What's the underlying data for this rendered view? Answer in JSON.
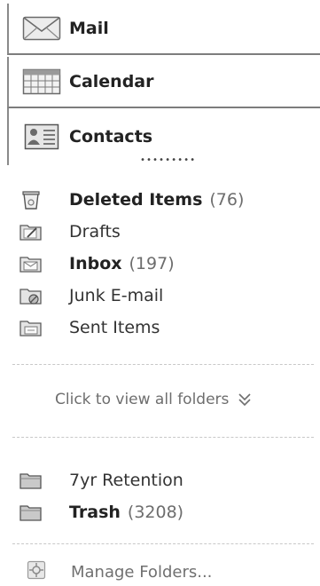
{
  "nav": {
    "mail": {
      "label": "Mail",
      "icon": "mail-envelope-icon"
    },
    "calendar": {
      "label": "Calendar",
      "icon": "calendar-icon"
    },
    "contacts": {
      "label": "Contacts",
      "icon": "contacts-card-icon"
    },
    "grip": "•••••••••"
  },
  "favorites": [
    {
      "name": "Deleted Items",
      "count": "(76)",
      "bold": true,
      "icon": "trash-can-icon"
    },
    {
      "name": "Drafts",
      "count": "",
      "bold": false,
      "icon": "drafts-folder-icon"
    },
    {
      "name": "Inbox",
      "count": "(197)",
      "bold": true,
      "icon": "inbox-folder-icon"
    },
    {
      "name": "Junk E-mail",
      "count": "",
      "bold": false,
      "icon": "junk-folder-icon"
    },
    {
      "name": "Sent Items",
      "count": "",
      "bold": false,
      "icon": "sent-folder-icon"
    }
  ],
  "view_all": {
    "label": "Click to view all folders",
    "icon": "double-chevron-down-icon"
  },
  "custom_folders": [
    {
      "name": "7yr Retention",
      "count": "",
      "bold": false,
      "icon": "folder-icon"
    },
    {
      "name": "Trash",
      "count": "(3208)",
      "bold": true,
      "icon": "folder-icon"
    }
  ],
  "manage": {
    "label": "Manage Folders...",
    "icon": "manage-folders-icon"
  },
  "colors": {
    "unread_count": "#6d6d6d",
    "muted_text": "#6e6e6e",
    "divider": "#c8c8c8"
  }
}
